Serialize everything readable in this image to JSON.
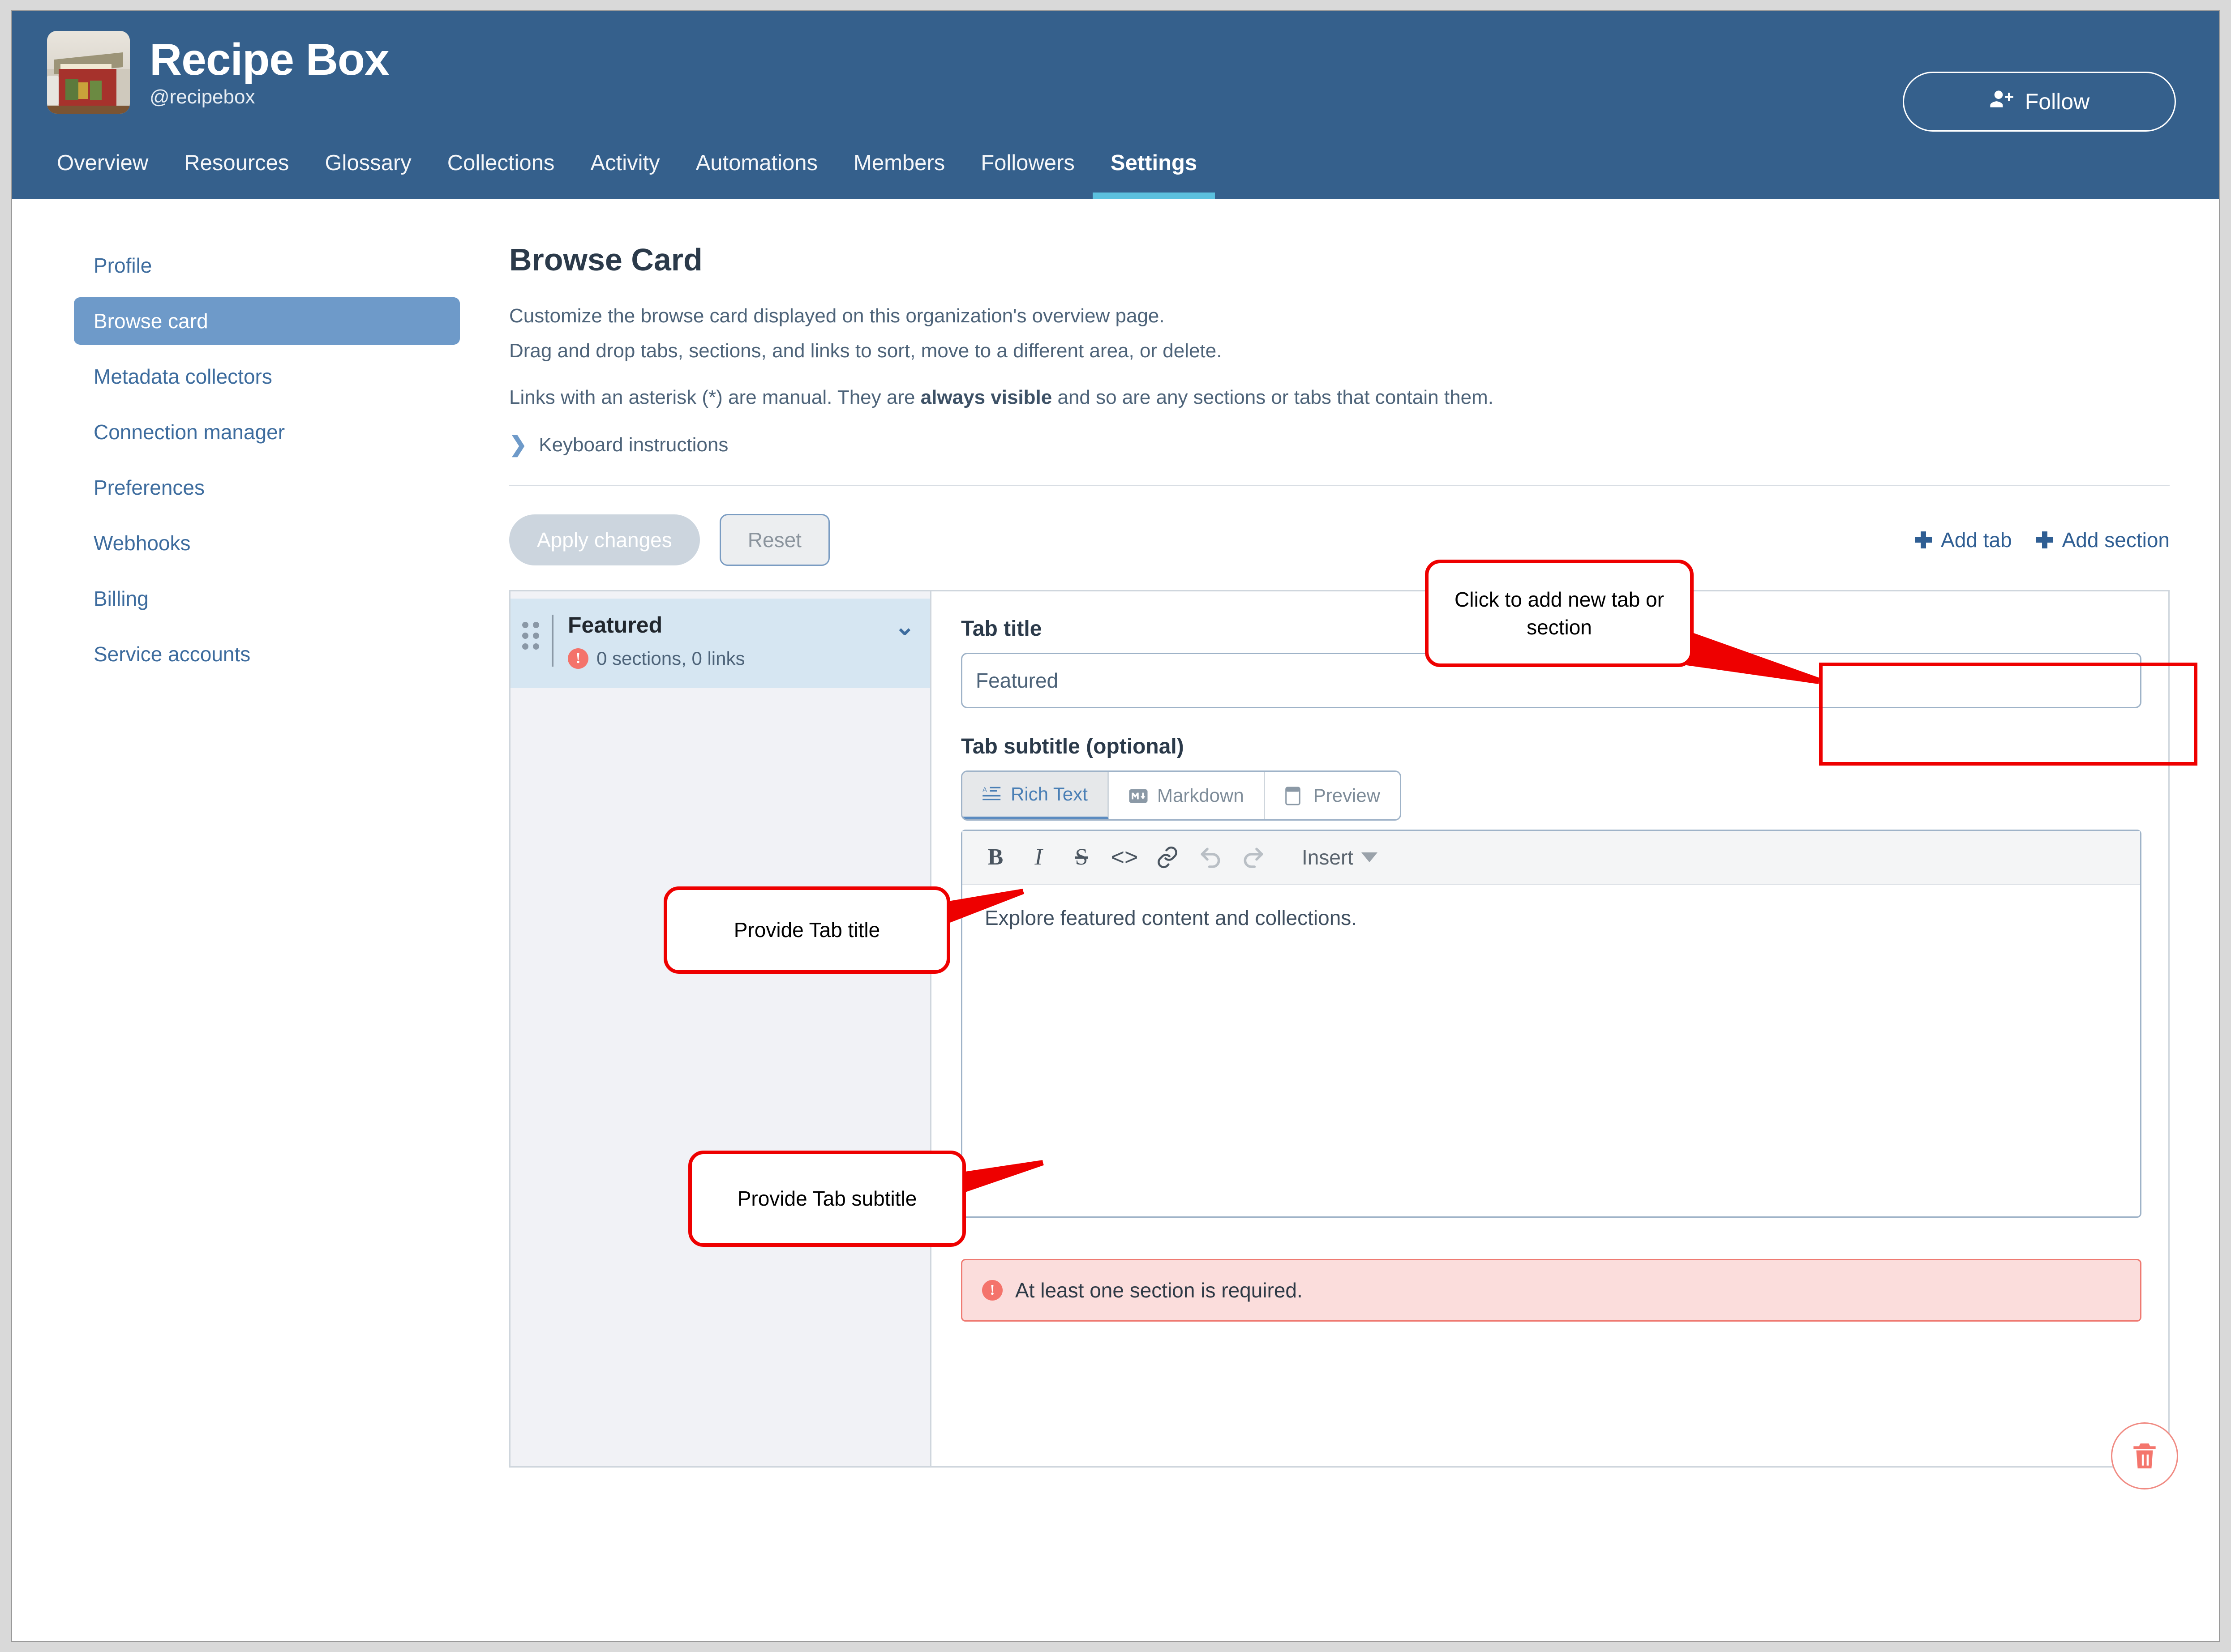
{
  "header": {
    "org_title": "Recipe Box",
    "org_handle": "@recipebox",
    "follow_label": "Follow",
    "avatar_alt": "recipe-box-photo",
    "brand_blue": "#35608c",
    "accent_cyan": "#5bc0de"
  },
  "nav": {
    "items": [
      {
        "label": "Overview",
        "active": false
      },
      {
        "label": "Resources",
        "active": false
      },
      {
        "label": "Glossary",
        "active": false
      },
      {
        "label": "Collections",
        "active": false
      },
      {
        "label": "Activity",
        "active": false
      },
      {
        "label": "Automations",
        "active": false
      },
      {
        "label": "Members",
        "active": false
      },
      {
        "label": "Followers",
        "active": false
      },
      {
        "label": "Settings",
        "active": true
      }
    ]
  },
  "sidebar": {
    "items": [
      {
        "label": "Profile",
        "active": false
      },
      {
        "label": "Browse card",
        "active": true
      },
      {
        "label": "Metadata collectors",
        "active": false
      },
      {
        "label": "Connection manager",
        "active": false
      },
      {
        "label": "Preferences",
        "active": false
      },
      {
        "label": "Webhooks",
        "active": false
      },
      {
        "label": "Billing",
        "active": false
      },
      {
        "label": "Service accounts",
        "active": false
      }
    ]
  },
  "main": {
    "title": "Browse Card",
    "desc_line1": "Customize the browse card displayed on this organization's overview page.",
    "desc_line2": "Drag and drop tabs, sections, and links to sort, move to a different area, or delete.",
    "asterisk_pre": "Links with an asterisk (*) are manual. They are ",
    "asterisk_bold": "always visible",
    "asterisk_post": " and so are any sections or tabs that contain them.",
    "keyboard_label": "Keyboard instructions"
  },
  "actions": {
    "apply_label": "Apply changes",
    "apply_disabled": true,
    "reset_label": "Reset",
    "add_tab_label": "Add tab",
    "add_section_label": "Add section"
  },
  "tab_list": {
    "entries": [
      {
        "name": "Featured",
        "meta": "0 sections, 0 links",
        "has_error": true
      }
    ]
  },
  "tab_detail": {
    "title_label": "Tab title",
    "title_value": "Featured",
    "title_placeholder": "Tab title",
    "subtitle_label": "Tab subtitle (optional)",
    "modes": [
      {
        "label": "Rich Text",
        "icon": "rich-text-icon",
        "active": true
      },
      {
        "label": "Markdown",
        "icon": "markdown-icon",
        "active": false
      },
      {
        "label": "Preview",
        "icon": "preview-icon",
        "active": false
      }
    ],
    "toolbar": {
      "bold": "B",
      "italic": "I",
      "strike": "S",
      "code": "<>",
      "link": "link-icon",
      "undo": "undo-icon",
      "redo": "redo-icon",
      "insert_label": "Insert"
    },
    "editor_body": "Explore featured content and collections.",
    "error_message": "At least one section is required.",
    "delete_label": "delete-tab"
  },
  "annotations": [
    {
      "id": "add-callout",
      "text": "Click to add new tab or section"
    },
    {
      "id": "tab-title-callout",
      "text": "Provide Tab title"
    },
    {
      "id": "tab-subtitle-callout",
      "text": "Provide Tab subtitle"
    }
  ]
}
